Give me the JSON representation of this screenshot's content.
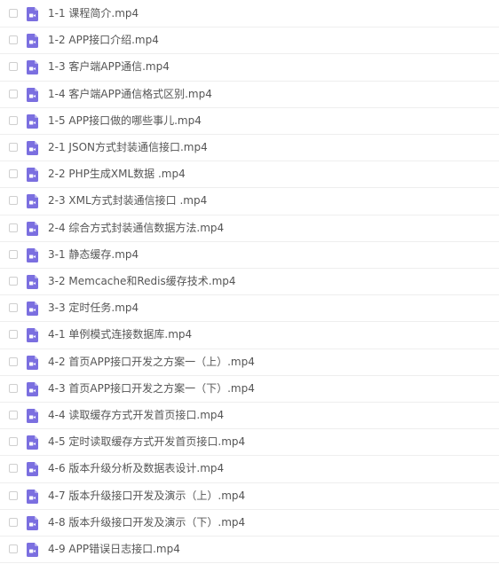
{
  "files": [
    {
      "name": "1-1 课程简介.mp4",
      "icon": "video-file-icon"
    },
    {
      "name": "1-2 APP接口介绍.mp4",
      "icon": "video-file-icon"
    },
    {
      "name": "1-3 客户端APP通信.mp4",
      "icon": "video-file-icon"
    },
    {
      "name": "1-4 客户端APP通信格式区别.mp4",
      "icon": "video-file-icon"
    },
    {
      "name": "1-5 APP接口做的哪些事儿.mp4",
      "icon": "video-file-icon"
    },
    {
      "name": "2-1 JSON方式封装通信接口.mp4",
      "icon": "video-file-icon"
    },
    {
      "name": "2-2 PHP生成XML数据 .mp4",
      "icon": "video-file-icon"
    },
    {
      "name": "2-3 XML方式封装通信接口 .mp4",
      "icon": "video-file-icon"
    },
    {
      "name": "2-4 综合方式封装通信数据方法.mp4",
      "icon": "video-file-icon"
    },
    {
      "name": "3-1 静态缓存.mp4",
      "icon": "video-file-icon"
    },
    {
      "name": "3-2 Memcache和Redis缓存技术.mp4",
      "icon": "video-file-icon"
    },
    {
      "name": "3-3 定时任务.mp4",
      "icon": "video-file-icon"
    },
    {
      "name": "4-1 单例模式连接数据库.mp4",
      "icon": "video-file-icon"
    },
    {
      "name": "4-2 首页APP接口开发之方案一（上）.mp4",
      "icon": "video-file-icon"
    },
    {
      "name": "4-3 首页APP接口开发之方案一（下）.mp4",
      "icon": "video-file-icon"
    },
    {
      "name": "4-4 读取缓存方式开发首页接口.mp4",
      "icon": "video-file-icon"
    },
    {
      "name": "4-5 定时读取缓存方式开发首页接口.mp4",
      "icon": "video-file-icon"
    },
    {
      "name": "4-6 版本升级分析及数据表设计.mp4",
      "icon": "video-file-icon"
    },
    {
      "name": "4-7 版本升级接口开发及演示（上）.mp4",
      "icon": "video-file-icon"
    },
    {
      "name": "4-8 版本升级接口开发及演示（下）.mp4",
      "icon": "video-file-icon"
    },
    {
      "name": "4-9 APP错误日志接口.mp4",
      "icon": "video-file-icon"
    }
  ],
  "colors": {
    "icon": "#7b6fe0",
    "text": "#555555",
    "divider": "#eeeeee"
  }
}
